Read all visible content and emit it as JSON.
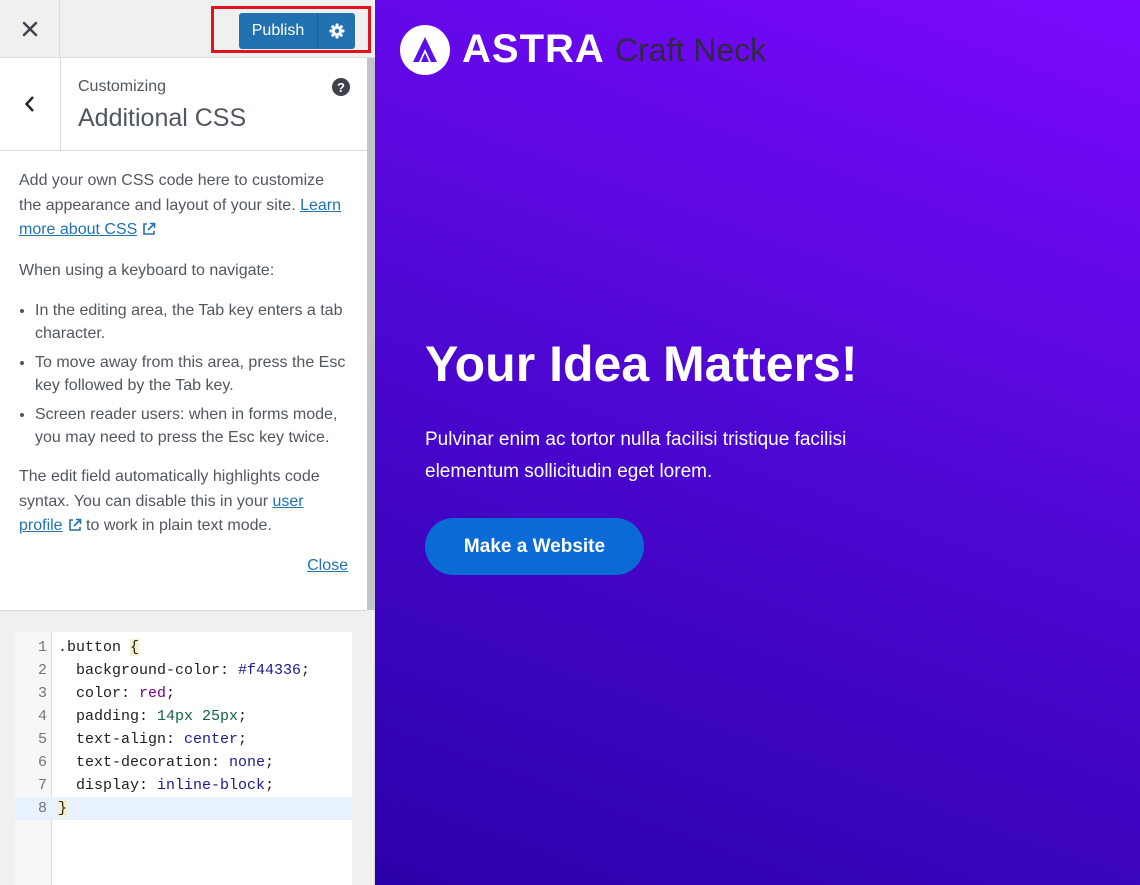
{
  "topbar": {
    "close_label": "Close customizer",
    "publish_label": "Publish"
  },
  "section": {
    "subtitle": "Customizing",
    "title": "Additional CSS",
    "help_glyph": "?"
  },
  "description": {
    "intro_text": "Add your own CSS code here to customize the appearance and layout of your site.",
    "learn_link": "Learn more about CSS",
    "keyboard_heading": "When using a keyboard to navigate:",
    "bullets": [
      "In the editing area, the Tab key enters a tab character.",
      "To move away from this area, press the Esc key followed by the Tab key.",
      "Screen reader users: when in forms mode, you may need to press the Esc key twice."
    ],
    "syntax_text_1": "The edit field automatically highlights code syntax. You can disable this in your",
    "profile_link": "user profile",
    "syntax_text_2": "to work in plain text mode.",
    "close_link": "Close"
  },
  "editor": {
    "line_numbers": [
      "1",
      "2",
      "3",
      "4",
      "5",
      "6",
      "7",
      "8"
    ],
    "selector": ".button ",
    "open_brace": "{",
    "close_brace": "}",
    "declarations": [
      {
        "prop": "  background-color: ",
        "value": "#f44336",
        "end": ";"
      },
      {
        "prop": "  color: ",
        "value": "red",
        "end": ";"
      },
      {
        "prop": "  padding: ",
        "value": "14px 25px",
        "end": ";"
      },
      {
        "prop": "  text-align: ",
        "value": "center",
        "end": ";"
      },
      {
        "prop": "  text-decoration: ",
        "value": "none",
        "end": ";"
      },
      {
        "prop": "  display: ",
        "value": "inline-block",
        "end": ";"
      }
    ]
  },
  "preview": {
    "logo_text": "ASTRA",
    "site_name": "Craft Neck",
    "hero_title": "Your Idea Matters!",
    "hero_text": "Pulvinar enim ac tortor nulla facilisi tristique facilisi elementum sollicitudin eget lorem.",
    "hero_button": "Make a Website"
  },
  "colors": {
    "primary": "#2271b1",
    "highlight_border": "#e0141e",
    "preview_gradient_start": "#7c09ff",
    "preview_gradient_end": "#2a01a9",
    "hero_button": "#0b6bd6"
  }
}
